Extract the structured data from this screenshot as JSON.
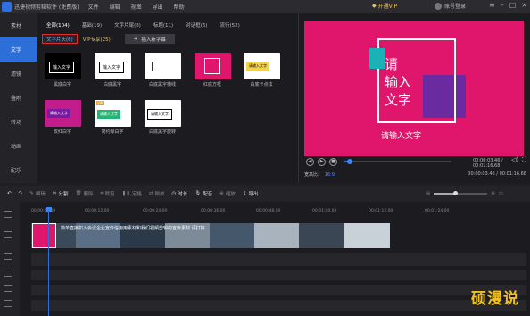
{
  "titlebar": {
    "app_title": "迅捷视频剪辑软件 (免费版)",
    "menus": [
      "文件",
      "编辑",
      "视图",
      "导出",
      "帮助"
    ],
    "vip": "开通VIP",
    "login": "账号登录"
  },
  "sidebar": {
    "items": [
      {
        "label": "素材",
        "active": false
      },
      {
        "label": "文字",
        "active": true
      },
      {
        "label": "滤镜",
        "active": false
      },
      {
        "label": "叠附",
        "active": false
      },
      {
        "label": "转场",
        "active": false
      },
      {
        "label": "动画",
        "active": false
      },
      {
        "label": "配乐",
        "active": false
      }
    ]
  },
  "panel": {
    "tabs": [
      "全部(104)",
      "基础(19)",
      "文字片尾(8)",
      "标题(11)",
      "对话框(6)",
      "流行(52)"
    ],
    "subtabs": {
      "selected": "文字片头(6)",
      "vip": "VIP专享(25)"
    },
    "add_button": "插入新字幕",
    "thumbs": [
      {
        "label": "黑底白字",
        "text": "输入文字"
      },
      {
        "label": "白底黑字",
        "text": "输入文字"
      },
      {
        "label": "白底黑字横线",
        "text": ""
      },
      {
        "label": "红底方框",
        "text": ""
      },
      {
        "label": "白底卡点炫",
        "text": "请输入文字"
      },
      {
        "label": "玫红白字",
        "text": "请输入文字"
      },
      {
        "label": "简约绿白字",
        "text": "请输入文字"
      },
      {
        "label": "白底黑字旋转",
        "text": "请输入文字"
      }
    ],
    "vip_badge": "VIP"
  },
  "preview": {
    "title_line1": "请",
    "title_line2": "输入",
    "title_line3": "文字",
    "caption": "请输入文字",
    "current_time": "00:00:03.46",
    "total_time": "00:01:16.68",
    "ratio_label": "宽高比:",
    "ratio_value": "16:9",
    "progress": 0.05
  },
  "toolbar": {
    "undo": "↶",
    "redo": "↷",
    "edit": "编辑",
    "cut": "分割",
    "delete": "删除",
    "crop": "裁剪",
    "freeze": "定格",
    "reverse": "倒放",
    "speed": "时长",
    "voice": "配音",
    "zoom_icon": "缩放",
    "export": "导出",
    "zoom_level": 0.4
  },
  "timeline": {
    "ruler": [
      "00:00:00.00",
      "00:00:12.00",
      "00:00:24.00",
      "00:00:36.00",
      "00:00:48.00",
      "00:01:00.00",
      "00:01:12.00",
      "00:01:24.00"
    ],
    "clip_label": "简单直接扣入会议企业宣传信用用素材和我们视频剪辑的宣传素材 请打好",
    "watermark": "硕漫说"
  },
  "colors": {
    "accent": "#2d6fd9",
    "preview_bg": "#e0156c",
    "selected_border": "#e02d2d",
    "vip": "#e6c36a"
  }
}
